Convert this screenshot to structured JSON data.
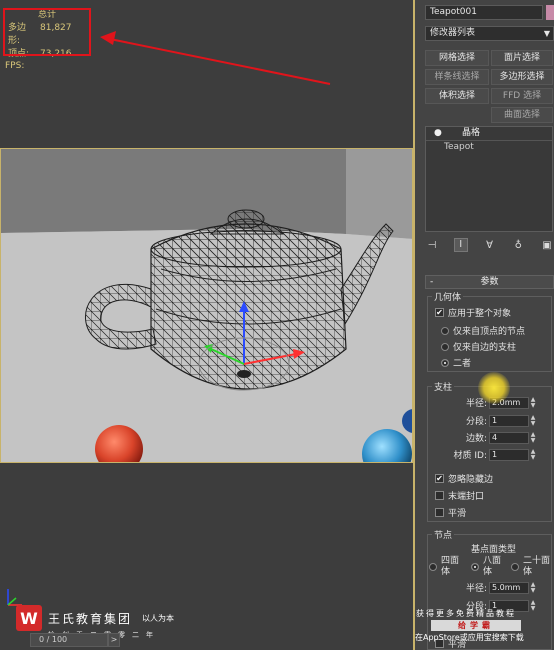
{
  "stats": {
    "total_label": "总计",
    "polygons_label": "多边形:",
    "polygons_value": "81,827",
    "vertices_label": "顶点:",
    "vertices_value": "73,216",
    "fps_label": "FPS:"
  },
  "panel": {
    "object_name": "Teapot001",
    "object_color": "#c78aa8",
    "modifier_list": "修改器列表",
    "select_buttons": [
      "网格选择",
      "面片选择",
      "样条线选择",
      "多边形选择",
      "体积选择",
      "FFD 选择",
      "曲面选择"
    ],
    "stack_header": "晶格",
    "stack_item": "Teapot",
    "rollout_title": "参数",
    "geometry": {
      "title": "几何体",
      "apply_all": "应用于整个对象",
      "options": [
        "仅来自顶点的节点",
        "仅来自边的支柱",
        "二者"
      ],
      "selected_option": 2
    },
    "struts": {
      "title": "支柱",
      "radius_label": "半径:",
      "radius_value": "2.0mm",
      "segments_label": "分段:",
      "segments_value": "1",
      "sides_label": "边数:",
      "sides_value": "4",
      "material_label": "材质 ID:",
      "material_value": "1",
      "ignore_hidden": "忽略隐藏边",
      "end_caps": "末端封口",
      "smooth": "平滑"
    },
    "joints": {
      "title": "节点",
      "type_label": "基点面类型",
      "types": [
        "四面体",
        "八面体",
        "二十面体"
      ],
      "selected_type": 1,
      "radius_label": "半径:",
      "radius_value": "5.0mm",
      "segments_label": "分段:",
      "segments_value": "1",
      "smooth": "平滑"
    }
  },
  "brand": {
    "logo_letter": "W",
    "name": "王氏教育集团",
    "tagline": "以人为本",
    "sub": "始创于二零零二年"
  },
  "timeline": {
    "position": "0 / 100",
    "next": ">"
  },
  "promo": {
    "line1": "获得更多免费精品教程",
    "button": "给学霸",
    "line3": "在AppStore或应用宝搜索下载"
  },
  "colors": {
    "highlight_box": "#e0141b",
    "stats_text": "#d9c77a",
    "viewport_border": "#c8b36a",
    "cursor_highlight": "#ffe03c"
  }
}
